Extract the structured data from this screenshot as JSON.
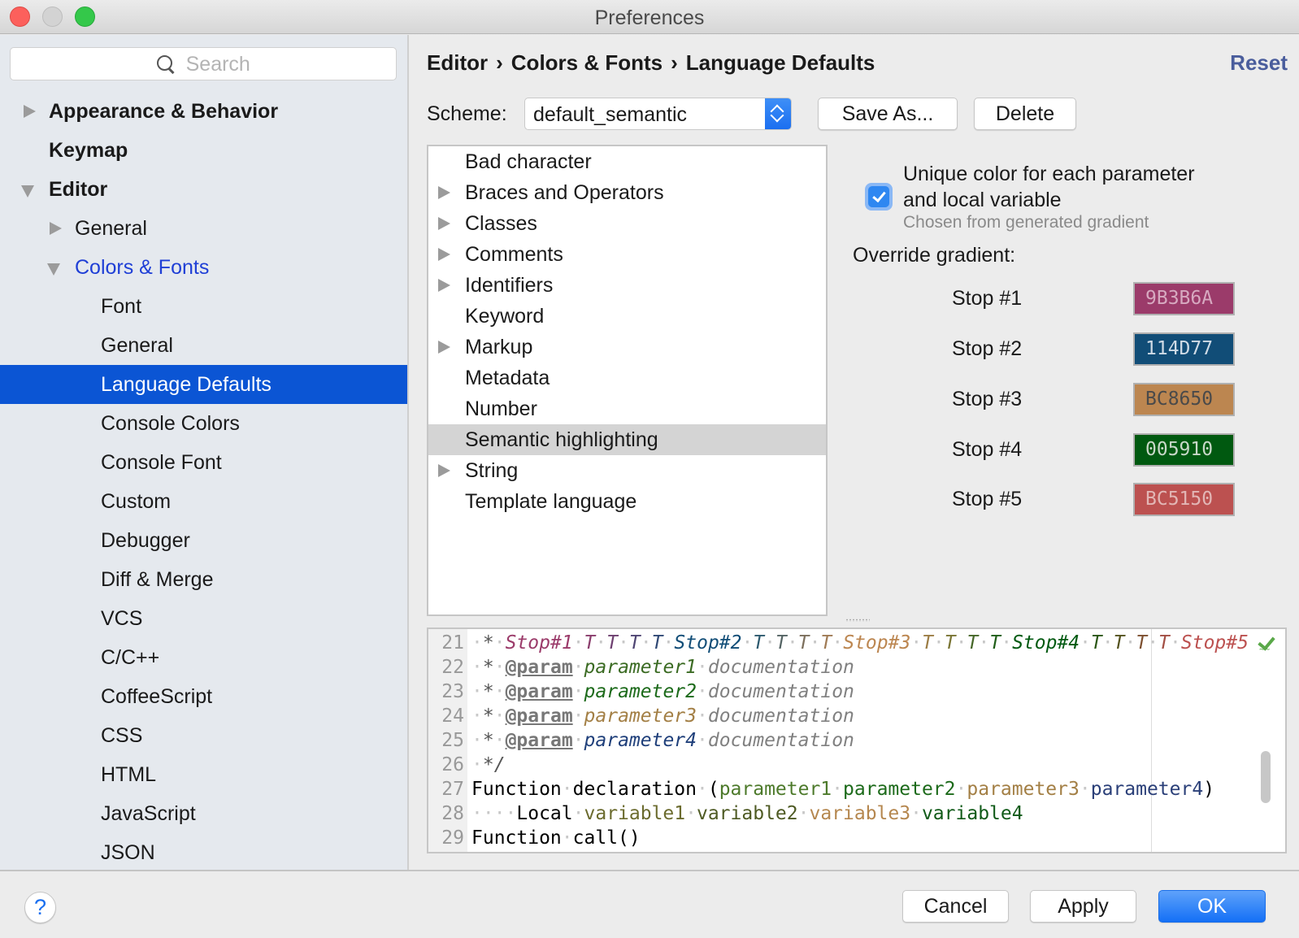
{
  "window": {
    "title": "Preferences"
  },
  "sidebar": {
    "search_placeholder": "Search",
    "items": [
      {
        "label": "Appearance & Behavior",
        "level": 0,
        "expander": "collapsed",
        "bold": true
      },
      {
        "label": "Keymap",
        "level": 0,
        "expander": "none",
        "bold": true
      },
      {
        "label": "Editor",
        "level": 0,
        "expander": "expanded",
        "bold": true
      },
      {
        "label": "General",
        "level": 1,
        "expander": "collapsed"
      },
      {
        "label": "Colors & Fonts",
        "level": 1,
        "expander": "expanded",
        "link": true
      },
      {
        "label": "Font",
        "level": 2
      },
      {
        "label": "General",
        "level": 2
      },
      {
        "label": "Language Defaults",
        "level": 2,
        "selected": true
      },
      {
        "label": "Console Colors",
        "level": 2
      },
      {
        "label": "Console Font",
        "level": 2
      },
      {
        "label": "Custom",
        "level": 2
      },
      {
        "label": "Debugger",
        "level": 2
      },
      {
        "label": "Diff & Merge",
        "level": 2
      },
      {
        "label": "VCS",
        "level": 2
      },
      {
        "label": "C/C++",
        "level": 2
      },
      {
        "label": "CoffeeScript",
        "level": 2
      },
      {
        "label": "CSS",
        "level": 2
      },
      {
        "label": "HTML",
        "level": 2
      },
      {
        "label": "JavaScript",
        "level": 2
      },
      {
        "label": "JSON",
        "level": 2
      }
    ]
  },
  "header": {
    "breadcrumb": [
      "Editor",
      "Colors & Fonts",
      "Language Defaults"
    ],
    "separator": "›",
    "reset_label": "Reset"
  },
  "scheme": {
    "label": "Scheme:",
    "value": "default_semantic",
    "save_as_label": "Save As...",
    "delete_label": "Delete"
  },
  "tree": {
    "items": [
      {
        "label": "Bad character",
        "expandable": false
      },
      {
        "label": "Braces and Operators",
        "expandable": true
      },
      {
        "label": "Classes",
        "expandable": true
      },
      {
        "label": "Comments",
        "expandable": true
      },
      {
        "label": "Identifiers",
        "expandable": true
      },
      {
        "label": "Keyword",
        "expandable": false
      },
      {
        "label": "Markup",
        "expandable": true
      },
      {
        "label": "Metadata",
        "expandable": false
      },
      {
        "label": "Number",
        "expandable": false
      },
      {
        "label": "Semantic highlighting",
        "expandable": false,
        "selected": true
      },
      {
        "label": "String",
        "expandable": true
      },
      {
        "label": "Template language",
        "expandable": false
      }
    ]
  },
  "options": {
    "unique_color_checked": true,
    "unique_color_label_line1": "Unique color for each parameter",
    "unique_color_label_line2": "and local variable",
    "hint": "Chosen from generated gradient",
    "override_label": "Override gradient:",
    "stops": [
      {
        "label": "Stop #1",
        "hex": "9B3B6A",
        "color": "#9B3B6A",
        "text_color": "#d7a9c0"
      },
      {
        "label": "Stop #2",
        "hex": "114D77",
        "color": "#114D77",
        "text_color": "#cfdbe6"
      },
      {
        "label": "Stop #3",
        "hex": "BC8650",
        "color": "#BC8650",
        "text_color": "#4a4a4a"
      },
      {
        "label": "Stop #4",
        "hex": "005910",
        "color": "#005910",
        "text_color": "#c8d8c8"
      },
      {
        "label": "Stop #5",
        "hex": "BC5150",
        "color": "#BC5150",
        "text_color": "#e2b6b5"
      }
    ]
  },
  "preview": {
    "lines": [
      {
        "num": "21",
        "tokens": [
          {
            "t": " ",
            "c": "dot"
          },
          {
            "t": "*",
            "c": "#555"
          },
          {
            "t": " ",
            "c": "dot"
          },
          {
            "t": "Stop#1",
            "c": "#9B3B6A",
            "i": true
          },
          {
            "t": " ",
            "c": "dot"
          },
          {
            "t": "T",
            "c": "#8a3d6c",
            "i": true
          },
          {
            "t": " ",
            "c": "dot"
          },
          {
            "t": "T",
            "c": "#6e4070",
            "i": true
          },
          {
            "t": " ",
            "c": "dot"
          },
          {
            "t": "T",
            "c": "#4f4573",
            "i": true
          },
          {
            "t": " ",
            "c": "dot"
          },
          {
            "t": "T",
            "c": "#304975",
            "i": true
          },
          {
            "t": " ",
            "c": "dot"
          },
          {
            "t": "Stop#2",
            "c": "#114D77",
            "i": true
          },
          {
            "t": " ",
            "c": "dot"
          },
          {
            "t": "T",
            "c": "#2d5a6f",
            "i": true
          },
          {
            "t": " ",
            "c": "dot"
          },
          {
            "t": "T",
            "c": "#556464",
            "i": true
          },
          {
            "t": " ",
            "c": "dot"
          },
          {
            "t": "T",
            "c": "#7c6f5c",
            "i": true
          },
          {
            "t": " ",
            "c": "dot"
          },
          {
            "t": "T",
            "c": "#a07b55",
            "i": true
          },
          {
            "t": " ",
            "c": "dot"
          },
          {
            "t": "Stop#3",
            "c": "#BC8650",
            "i": true
          },
          {
            "t": " ",
            "c": "dot"
          },
          {
            "t": "T",
            "c": "#9c7d45",
            "i": true
          },
          {
            "t": " ",
            "c": "dot"
          },
          {
            "t": "T",
            "c": "#7a7535",
            "i": true
          },
          {
            "t": " ",
            "c": "dot"
          },
          {
            "t": "T",
            "c": "#466728",
            "i": true
          },
          {
            "t": " ",
            "c": "dot"
          },
          {
            "t": "T",
            "c": "#1f5e18",
            "i": true
          },
          {
            "t": " ",
            "c": "dot"
          },
          {
            "t": "Stop#4",
            "c": "#005910",
            "i": true
          },
          {
            "t": " ",
            "c": "dot"
          },
          {
            "t": "T",
            "c": "#2b5716",
            "i": true
          },
          {
            "t": " ",
            "c": "dot"
          },
          {
            "t": "T",
            "c": "#55531f",
            "i": true
          },
          {
            "t": " ",
            "c": "dot"
          },
          {
            "t": "T",
            "c": "#7d5030",
            "i": true
          },
          {
            "t": " ",
            "c": "dot"
          },
          {
            "t": "T",
            "c": "#a34f44",
            "i": true
          },
          {
            "t": " ",
            "c": "dot"
          },
          {
            "t": "Stop#5",
            "c": "#BC5150",
            "i": true
          }
        ]
      },
      {
        "num": "22",
        "tokens": [
          {
            "t": " ",
            "c": "dot"
          },
          {
            "t": "*",
            "c": "#555"
          },
          {
            "t": " ",
            "c": "dot"
          },
          {
            "t": "@param",
            "c": "#777",
            "u": true,
            "b": true
          },
          {
            "t": " ",
            "c": "dot"
          },
          {
            "t": "parameter1",
            "c": "#3b6b23",
            "i": true
          },
          {
            "t": " ",
            "c": "dot"
          },
          {
            "t": "documentation",
            "c": "#808080",
            "i": true
          }
        ]
      },
      {
        "num": "23",
        "tokens": [
          {
            "t": " ",
            "c": "dot"
          },
          {
            "t": "*",
            "c": "#555"
          },
          {
            "t": " ",
            "c": "dot"
          },
          {
            "t": "@param",
            "c": "#777",
            "u": true,
            "b": true
          },
          {
            "t": " ",
            "c": "dot"
          },
          {
            "t": "parameter2",
            "c": "#1c6a1a",
            "i": true
          },
          {
            "t": " ",
            "c": "dot"
          },
          {
            "t": "documentation",
            "c": "#808080",
            "i": true
          }
        ]
      },
      {
        "num": "24",
        "tokens": [
          {
            "t": " ",
            "c": "dot"
          },
          {
            "t": "*",
            "c": "#555"
          },
          {
            "t": " ",
            "c": "dot"
          },
          {
            "t": "@param",
            "c": "#777",
            "u": true,
            "b": true
          },
          {
            "t": " ",
            "c": "dot"
          },
          {
            "t": "parameter3",
            "c": "#a37f45",
            "i": true
          },
          {
            "t": " ",
            "c": "dot"
          },
          {
            "t": "documentation",
            "c": "#808080",
            "i": true
          }
        ]
      },
      {
        "num": "25",
        "tokens": [
          {
            "t": " ",
            "c": "dot"
          },
          {
            "t": "*",
            "c": "#555"
          },
          {
            "t": " ",
            "c": "dot"
          },
          {
            "t": "@param",
            "c": "#777",
            "u": true,
            "b": true
          },
          {
            "t": " ",
            "c": "dot"
          },
          {
            "t": "parameter4",
            "c": "#1f3f7a",
            "i": true
          },
          {
            "t": " ",
            "c": "dot"
          },
          {
            "t": "documentation",
            "c": "#808080",
            "i": true
          }
        ]
      },
      {
        "num": "26",
        "tokens": [
          {
            "t": " ",
            "c": "dot"
          },
          {
            "t": "*/",
            "c": "#555",
            "i": true
          }
        ]
      },
      {
        "num": "27",
        "tokens": [
          {
            "t": "Function",
            "c": "#000"
          },
          {
            "t": " ",
            "c": "dot"
          },
          {
            "t": "declaration",
            "c": "#000"
          },
          {
            "t": " ",
            "c": "dot"
          },
          {
            "t": "(",
            "c": "#000"
          },
          {
            "t": "parameter1",
            "c": "#4d7a2b"
          },
          {
            "t": " ",
            "c": "dot"
          },
          {
            "t": "parameter2",
            "c": "#1c6a1a"
          },
          {
            "t": " ",
            "c": "dot"
          },
          {
            "t": "parameter3",
            "c": "#a37f45"
          },
          {
            "t": " ",
            "c": "dot"
          },
          {
            "t": "parameter4",
            "c": "#2a3f78"
          },
          {
            "t": ")",
            "c": "#000"
          }
        ]
      },
      {
        "num": "28",
        "tokens": [
          {
            "t": "    ",
            "c": "dot"
          },
          {
            "t": "Local",
            "c": "#000"
          },
          {
            "t": " ",
            "c": "dot"
          },
          {
            "t": "variable1",
            "c": "#6b6b2e"
          },
          {
            "t": " ",
            "c": "dot"
          },
          {
            "t": "variable2",
            "c": "#4e5a23"
          },
          {
            "t": " ",
            "c": "dot"
          },
          {
            "t": "variable3",
            "c": "#b5874f"
          },
          {
            "t": " ",
            "c": "dot"
          },
          {
            "t": "variable4",
            "c": "#105a18"
          }
        ]
      },
      {
        "num": "29",
        "tokens": [
          {
            "t": "Function",
            "c": "#000"
          },
          {
            "t": " ",
            "c": "dot"
          },
          {
            "t": "call()",
            "c": "#000"
          }
        ]
      }
    ]
  },
  "footer": {
    "help_label": "?",
    "cancel_label": "Cancel",
    "apply_label": "Apply",
    "ok_label": "OK"
  }
}
